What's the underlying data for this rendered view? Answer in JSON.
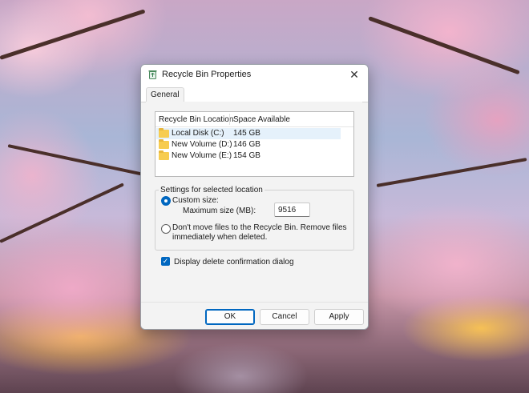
{
  "window": {
    "title": "Recycle Bin Properties",
    "close_glyph": "✕",
    "icon": "recycle-bin-icon"
  },
  "tabs": [
    {
      "label": "General",
      "selected": true
    }
  ],
  "locations_list": {
    "columns": [
      "Recycle Bin Location",
      "Space Available"
    ],
    "rows": [
      {
        "location": "Local Disk (C:)",
        "space": "145 GB",
        "selected": true,
        "icon": "folder-icon"
      },
      {
        "location": "New Volume (D:)",
        "space": "146 GB",
        "selected": false,
        "icon": "folder-icon"
      },
      {
        "location": "New Volume (E:)",
        "space": "154 GB",
        "selected": false,
        "icon": "folder-icon"
      }
    ]
  },
  "settings": {
    "group_label": "Settings for selected location",
    "custom_size_label": "Custom size:",
    "custom_size_selected": true,
    "max_size_label": "Maximum size (MB):",
    "max_size_value": "9516",
    "dont_move_line1": "Don't move files to the Recycle Bin. Remove files",
    "dont_move_line2": "immediately when deleted.",
    "dont_move_selected": false
  },
  "confirm": {
    "label": "Display delete confirmation dialog",
    "checked": true,
    "check_glyph": "✓"
  },
  "buttons": {
    "ok": "OK",
    "cancel": "Cancel",
    "apply": "Apply"
  },
  "colors": {
    "accent": "#0067c0",
    "selection": "#e5f1fb",
    "folder": "#f7cc4f"
  }
}
